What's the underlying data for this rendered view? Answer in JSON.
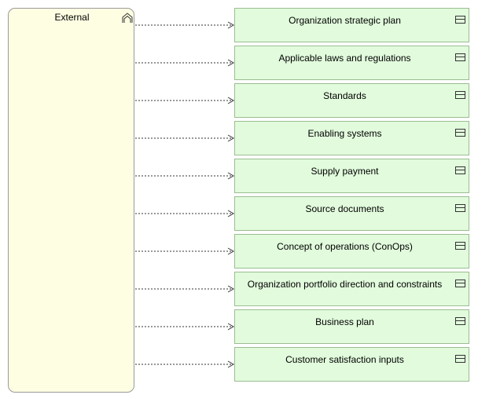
{
  "external": {
    "label": "External",
    "icon": "collaboration-icon",
    "fill": "#fefee3"
  },
  "colors": {
    "box_fill": "#e1fbdc",
    "box_border": "#9bbd91",
    "connector": "#333333"
  },
  "boxes": [
    {
      "label": "Organization strategic plan",
      "icon": "object-icon"
    },
    {
      "label": "Applicable laws and regulations",
      "icon": "object-icon"
    },
    {
      "label": "Standards",
      "icon": "object-icon"
    },
    {
      "label": "Enabling systems",
      "icon": "object-icon"
    },
    {
      "label": "Supply payment",
      "icon": "object-icon"
    },
    {
      "label": "Source documents",
      "icon": "object-icon"
    },
    {
      "label": "Concept of operations (ConOps)",
      "icon": "object-icon"
    },
    {
      "label": "Organization portfolio direction and constraints",
      "icon": "object-icon"
    },
    {
      "label": "Business plan",
      "icon": "object-icon"
    },
    {
      "label": "Customer satisfaction inputs",
      "icon": "object-icon"
    }
  ]
}
